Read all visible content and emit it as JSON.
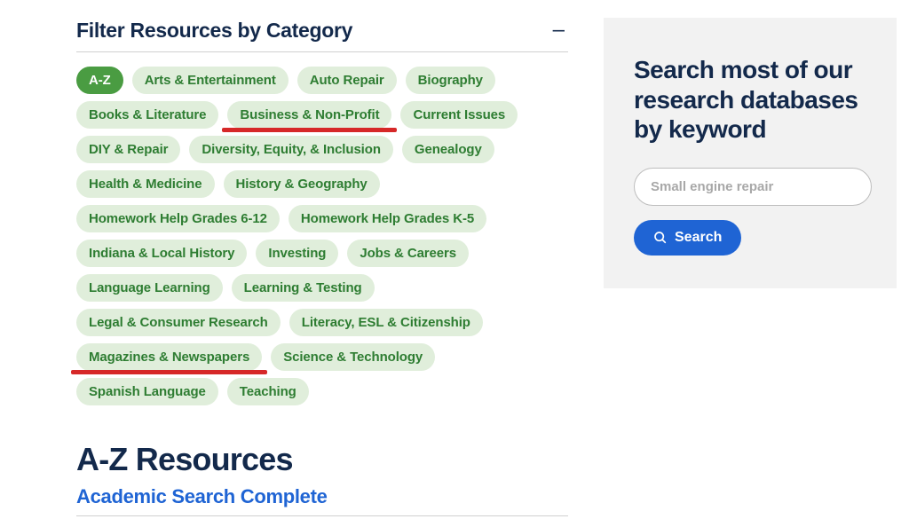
{
  "filter": {
    "title": "Filter Resources by Category",
    "collapse": "–",
    "pills": [
      {
        "label": "A-Z",
        "active": true,
        "underline": false
      },
      {
        "label": "Arts & Entertainment",
        "active": false,
        "underline": false
      },
      {
        "label": "Auto Repair",
        "active": false,
        "underline": false
      },
      {
        "label": "Biography",
        "active": false,
        "underline": false
      },
      {
        "label": "Books & Literature",
        "active": false,
        "underline": false
      },
      {
        "label": "Business & Non-Profit",
        "active": false,
        "underline": true
      },
      {
        "label": "Current Issues",
        "active": false,
        "underline": false
      },
      {
        "label": "DIY & Repair",
        "active": false,
        "underline": false
      },
      {
        "label": "Diversity, Equity, & Inclusion",
        "active": false,
        "underline": false
      },
      {
        "label": "Genealogy",
        "active": false,
        "underline": false
      },
      {
        "label": "Health & Medicine",
        "active": false,
        "underline": false
      },
      {
        "label": "History & Geography",
        "active": false,
        "underline": false
      },
      {
        "label": "Homework Help Grades 6-12",
        "active": false,
        "underline": false
      },
      {
        "label": "Homework Help Grades K-5",
        "active": false,
        "underline": false
      },
      {
        "label": "Indiana & Local History",
        "active": false,
        "underline": false
      },
      {
        "label": "Investing",
        "active": false,
        "underline": false
      },
      {
        "label": "Jobs & Careers",
        "active": false,
        "underline": false
      },
      {
        "label": "Language Learning",
        "active": false,
        "underline": false
      },
      {
        "label": "Learning & Testing",
        "active": false,
        "underline": false
      },
      {
        "label": "Legal & Consumer Research",
        "active": false,
        "underline": false
      },
      {
        "label": "Literacy, ESL & Citizenship",
        "active": false,
        "underline": false
      },
      {
        "label": "Magazines & Newspapers",
        "active": false,
        "underline": true
      },
      {
        "label": "Science & Technology",
        "active": false,
        "underline": false
      },
      {
        "label": "Spanish Language",
        "active": false,
        "underline": false
      },
      {
        "label": "Teaching",
        "active": false,
        "underline": false
      }
    ]
  },
  "results": {
    "heading": "A-Z Resources",
    "items": [
      {
        "title": "Academic Search Complete"
      }
    ]
  },
  "search": {
    "title": "Search most of our research databases by keyword",
    "placeholder": "Small engine repair",
    "button": "Search"
  }
}
